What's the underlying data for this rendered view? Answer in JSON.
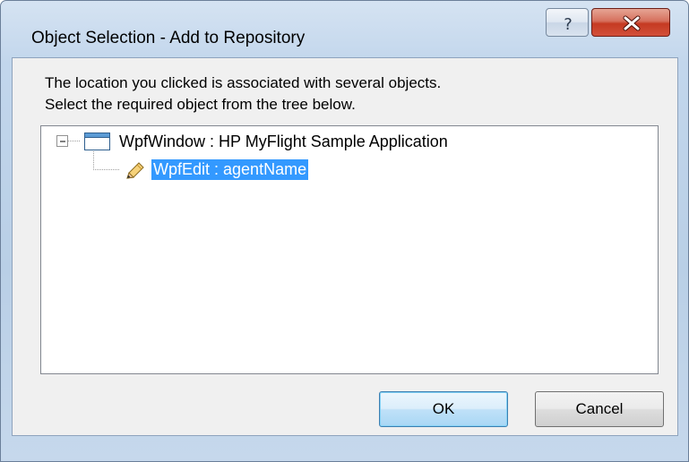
{
  "window": {
    "title": "Object Selection - Add to Repository",
    "help_icon": "question-mark-icon",
    "close_icon": "close-x-icon"
  },
  "message": {
    "line1": "The location you clicked is associated with several objects.",
    "line2": "Select the required object from the tree below."
  },
  "tree": {
    "root": {
      "label": "WpfWindow : HP MyFlight Sample Application",
      "icon": "window-icon",
      "expanded": true
    },
    "children": [
      {
        "label": "WpfEdit : agentName",
        "icon": "pencil-icon",
        "selected": true
      }
    ]
  },
  "buttons": {
    "ok_label": "OK",
    "cancel_label": "Cancel"
  },
  "colors": {
    "selection": "#3399ff",
    "close_button": "#c53a22"
  }
}
